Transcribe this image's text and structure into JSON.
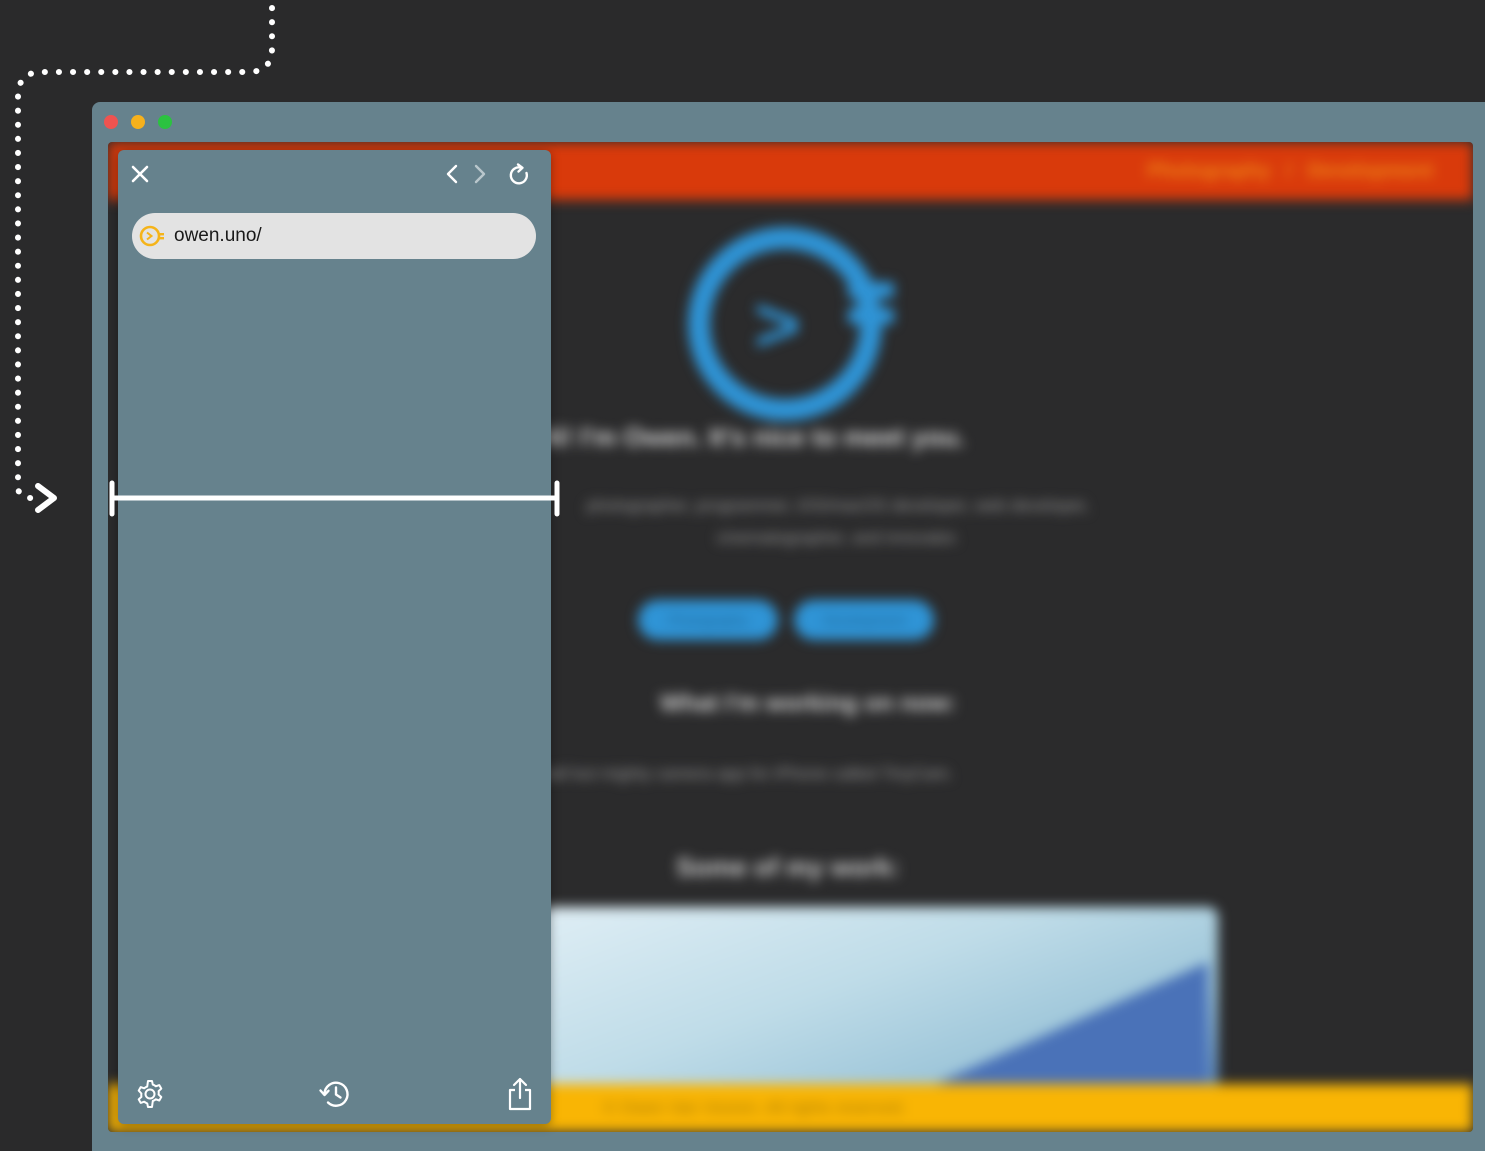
{
  "browser": {
    "url": "owen.uno/"
  },
  "site": {
    "nav": [
      "Photography",
      "/",
      "Development"
    ],
    "greeting": "Hi! I'm Owen. It's nice to meet you.",
    "intro": "photographer, programmer, iOS/macOS developer, web developer, cinematographer, and innovator.",
    "buttons": [
      "Photography",
      "Development"
    ],
    "working_heading": "What I'm working on now:",
    "working_text": "small but mighty camera app for iPhone called TinyCam.",
    "work_heading": "Some of my work:",
    "footer": "© Owen Van Vooren. All rights reserved."
  },
  "colors": {
    "accent": "#f5b41a",
    "panel_bg": "#66828d",
    "site_header": "#d93a0b",
    "site_footer": "#f9b504",
    "logo_blue": "#2f94d6"
  },
  "icons": {
    "close": "close-icon",
    "back": "chevron-left-icon",
    "forward": "chevron-right-icon",
    "reload": "reload-icon",
    "settings": "gear-icon",
    "history": "history-icon",
    "share": "share-icon"
  }
}
